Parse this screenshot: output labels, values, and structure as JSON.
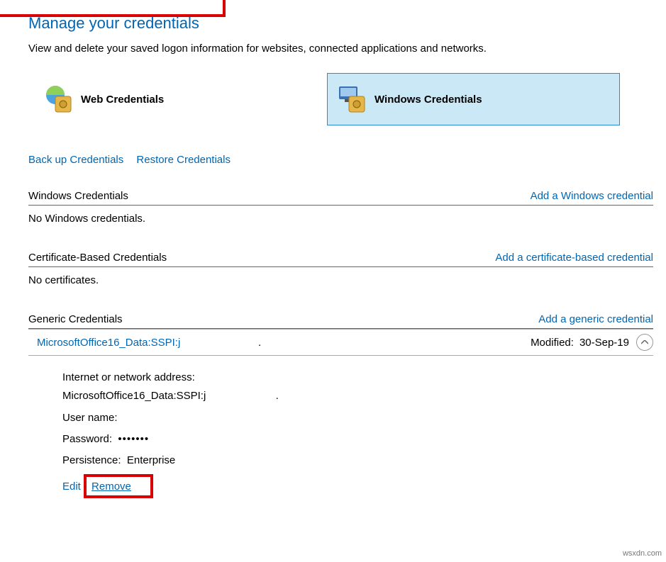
{
  "title": "Manage your credentials",
  "subtitle": "View and delete your saved logon information for websites, connected applications and networks.",
  "tabs": {
    "web": "Web Credentials",
    "windows": "Windows Credentials"
  },
  "links": {
    "backup": "Back up Credentials",
    "restore": "Restore Credentials"
  },
  "sections": {
    "win": {
      "title": "Windows Credentials",
      "add": "Add a Windows credential",
      "empty": "No Windows credentials."
    },
    "cert": {
      "title": "Certificate-Based Credentials",
      "add": "Add a certificate-based credential",
      "empty": "No certificates."
    },
    "generic": {
      "title": "Generic Credentials",
      "add": "Add a generic credential"
    }
  },
  "cred": {
    "name": "MicrosoftOffice16_Data:SSPI:j",
    "period": ".",
    "modified_label": "Modified:",
    "modified_date": "30-Sep-19",
    "addr_label": "Internet or network address:",
    "addr_value": "MicrosoftOffice16_Data:SSPI:j",
    "user_label": "User name:",
    "user_value": "",
    "pw_label": "Password:",
    "pw_value": "•••••••",
    "persist_label": "Persistence:",
    "persist_value": "Enterprise",
    "edit": "Edit",
    "remove": "Remove"
  },
  "watermark": "wsxdn.com"
}
